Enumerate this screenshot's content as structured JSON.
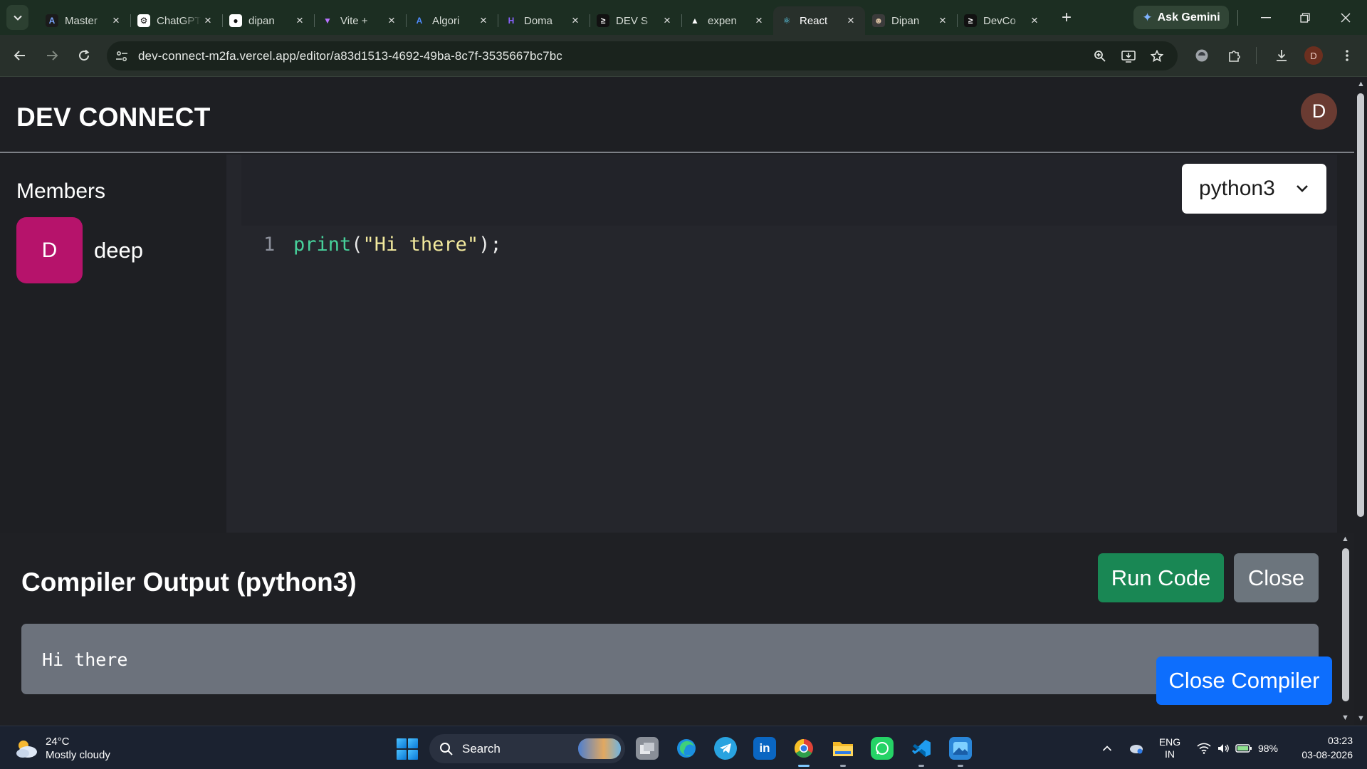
{
  "browser": {
    "tabs": [
      {
        "title": "Master",
        "favicon": "A",
        "favicon_color": "#1b1b1b",
        "favicon_fg": "#7aa7ff"
      },
      {
        "title": "ChatGPT",
        "favicon": "⚙",
        "favicon_color": "#ffffff",
        "favicon_fg": "#111111"
      },
      {
        "title": "dipan",
        "favicon": "●",
        "favicon_color": "#ffffff",
        "favicon_fg": "#111111"
      },
      {
        "title": "Vite +",
        "favicon": "▼",
        "favicon_color": "transparent",
        "favicon_fg": "#b873ff"
      },
      {
        "title": "Algori",
        "favicon": "A",
        "favicon_color": "transparent",
        "favicon_fg": "#4f8cff"
      },
      {
        "title": "Doma",
        "favicon": "H",
        "favicon_color": "transparent",
        "favicon_fg": "#8a63ff"
      },
      {
        "title": "DEV S",
        "favicon": "≥",
        "favicon_color": "#111111",
        "favicon_fg": "#ffffff"
      },
      {
        "title": "expen",
        "favicon": "▲",
        "favicon_color": "transparent",
        "favicon_fg": "#ffffff"
      },
      {
        "title": "React",
        "favicon": "⚛",
        "favicon_color": "transparent",
        "favicon_fg": "#61dafb",
        "active": true
      },
      {
        "title": "Dipan",
        "favicon": "☻",
        "favicon_color": "#3b3b3b",
        "favicon_fg": "#d8c0a0"
      },
      {
        "title": "DevCo",
        "favicon": "≥",
        "favicon_color": "#111111",
        "favicon_fg": "#ffffff"
      }
    ],
    "new_tab": "+",
    "ask_gemini": "Ask Gemini",
    "url": "dev-connect-m2fa.vercel.app/editor/a83d1513-4692-49ba-8c7f-3535667bc7bc",
    "profile_initial": "D"
  },
  "app": {
    "brand": "DEV CONNECT",
    "user_initial": "D",
    "members_title": "Members",
    "members": [
      {
        "initial": "D",
        "name": "deep"
      }
    ],
    "language": "python3",
    "code": {
      "line_number": "1",
      "fn": "print",
      "open": "(",
      "string": "\"Hi there\"",
      "close": ");"
    },
    "compiler": {
      "title": "Compiler Output (python3)",
      "run_label": "Run Code",
      "close_label": "Close",
      "output": "Hi there",
      "close_compiler_label": "Close Compiler"
    }
  },
  "taskbar": {
    "temperature": "24°C",
    "weather": "Mostly cloudy",
    "search_placeholder": "Search",
    "lang_top": "ENG",
    "lang_bottom": "IN",
    "battery": "98%",
    "time": "03:23",
    "date": "03-08-2026"
  },
  "colors": {
    "run_button": "#198754",
    "close_button": "#6c757d",
    "close_compiler_button": "#0d6efd",
    "member_avatar": "#b6136b"
  }
}
